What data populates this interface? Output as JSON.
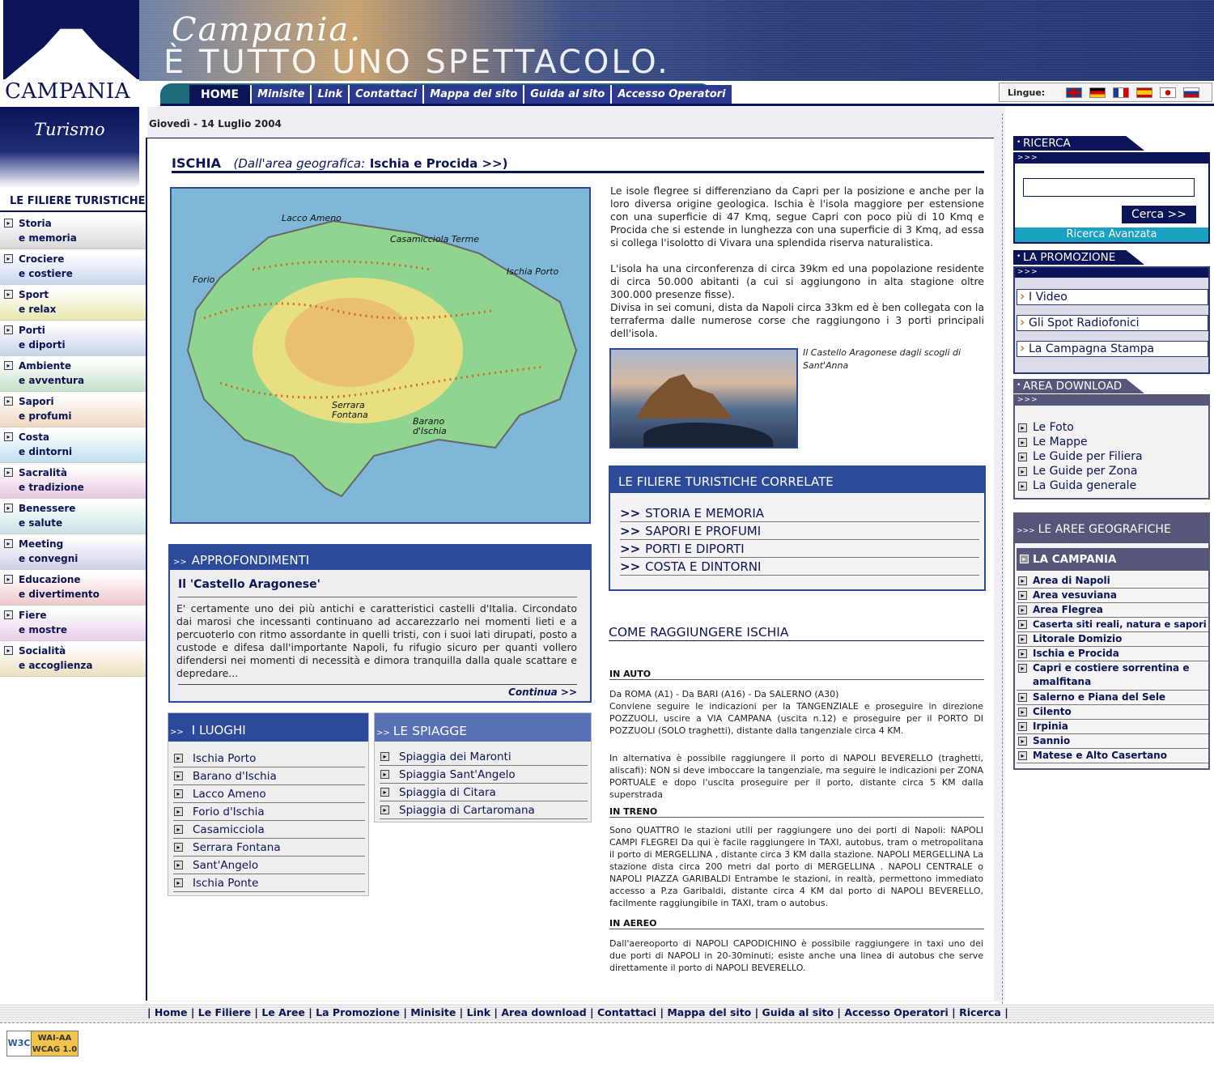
{
  "header": {
    "logo_text": "CAMPANIA",
    "logo_subtitle": "Turismo",
    "banner_line1": "Campania.",
    "banner_line2": "È TUTTO UNO SPETTACOLO.",
    "menu": [
      "HOME",
      "Minisite",
      "Link",
      "Contattaci",
      "Mappa del sito",
      "Guida al sito",
      "Accesso Operatori"
    ],
    "languages_label": "Lingue:",
    "languages": [
      "english-flag-icon",
      "german-flag-icon",
      "french-flag-icon",
      "spanish-flag-icon",
      "japanese-flag-icon",
      "russian-flag-icon"
    ]
  },
  "date": "Giovedì - 14 Luglio 2004",
  "left_nav": {
    "title": "LE FILIERE TURISTICHE",
    "items": [
      {
        "l1": "Storia",
        "l2": "e memoria",
        "color": "#d9d9d9"
      },
      {
        "l1": "Crociere",
        "l2": "e costiere",
        "color": "#c8d8ee"
      },
      {
        "l1": "Sport",
        "l2": "e relax",
        "color": "#e8e8b0"
      },
      {
        "l1": "Porti",
        "l2": "e diporti",
        "color": "#c8d4e8"
      },
      {
        "l1": "Ambiente",
        "l2": "e avventura",
        "color": "#c8e0c8"
      },
      {
        "l1": "Sapori",
        "l2": "e profumi",
        "color": "#f0d8c0"
      },
      {
        "l1": "Costa",
        "l2": "e dintorni",
        "color": "#c0e0f0"
      },
      {
        "l1": "Sacralità",
        "l2": "e tradizione",
        "color": "#e8c8e0"
      },
      {
        "l1": "Benessere",
        "l2": "e salute",
        "color": "#c8e4e4"
      },
      {
        "l1": "Meeting",
        "l2": "e convegni",
        "color": "#d0d0e8"
      },
      {
        "l1": "Educazione",
        "l2": "e divertimento",
        "color": "#f0c8c8"
      },
      {
        "l1": "Fiere",
        "l2": "e mostre",
        "color": "#e8d0e8"
      },
      {
        "l1": "Socialità",
        "l2": "e accoglienza",
        "color": "#ece0c0"
      }
    ]
  },
  "page": {
    "title": "ISCHIA",
    "area_prefix": "(Dall'area geografica:",
    "area_link": "Ischia e Procida >>)"
  },
  "map_labels": {
    "lacco": "Lacco  Ameno",
    "casamicciola": "Casamicciola  Terme",
    "ischia_porto": "Ischia  Porto",
    "forio": "Forio",
    "serrara": "Serrara Fontana",
    "barano": "Barano d'Ischia"
  },
  "description": {
    "p1": "Le isole flegree si differenziano da Capri per la posizione e anche per la loro diversa origine geologica. Ischia è l'isola maggiore per estensione con una superficie di 47 Kmq, segue Capri con poco più di 10 Kmq e Procida che si estende in lunghezza con una superficie di 3 Kmq, ad essa si collega l'isolotto di Vivara una splendida riserva naturalistica.",
    "p2": "L'isola ha una circonferenza di circa 39km ed una popolazione residente di circa 50.000 abitanti (a cui si aggiungono in alta stagione oltre 300.000 presenze fisse).",
    "p3": "Divisa in sei comuni, dista da Napoli circa 33km ed è ben collegata con la terraferma dalle numerose corse che raggiungono i 3 porti principali dell'isola."
  },
  "photo_caption": "Il Castello Aragonese dagli scogli di Sant'Anna",
  "correlate": {
    "title": "LE FILIERE TURISTICHE CORRELATE",
    "items": [
      "STORIA E MEMORIA",
      "SAPORI E PROFUMI",
      "PORTI E DIPORTI",
      "COSTA E DINTORNI"
    ],
    "marker": ">>"
  },
  "come": {
    "title": "COME RAGGIUNGERE ISCHIA",
    "auto_h": "IN AUTO",
    "auto_1": "Da ROMA (A1) - Da BARI (A16) - Da SALERNO (A30)",
    "auto_2": "Conviene seguire le indicazioni per la TANGENZIALE e proseguire in direzione POZZUOLI, uscire a VIA CAMPANA (uscita n.12) e proseguire per il PORTO DI POZZUOLI (SOLO traghetti), distante dalla tangenziale circa 4 KM.",
    "auto_3": "In alternativa è possibile raggiungere il porto di NAPOLI BEVERELLO (traghetti, aliscafi): NON si deve imboccare la tangenziale, ma seguire le indicazioni per ZONA PORTUALE e dopo l'uscita proseguire per il porto, distante circa 5 KM dalla superstrada",
    "treno_h": "IN TRENO",
    "treno": "Sono QUATTRO le stazioni utili per raggiungere uno dei porti di Napoli: NAPOLI CAMPI FLEGREI Da qui è facile raggiungere in TAXI, autobus, tram o metropolitana il porto di MERGELLINA , distante circa 3 KM dalla stazione. NAPOLI MERGELLINA La stazione dista circa 200 metri dal porto di MERGELLINA . NAPOLI CENTRALE o NAPOLI PIAZZA GARIBALDI Entrambe le stazioni, in realtà, permettono immediato accesso a P.za Garibaldi, distante circa 4 KM dal porto di NAPOLI BEVERELLO, facilmente raggiungibile in TAXI, tram o autobus.",
    "aereo_h": "IN AEREO",
    "aereo": "Dall'aereoporto di NAPOLI CAPODICHINO è possibile raggiungere in taxi uno dei due porti di NAPOLI in 20-30minuti; esiste anche una linea di autobus che serve direttamente il porto di NAPOLI BEVERELLO."
  },
  "approfondimenti": {
    "marker": ">>",
    "title": "APPROFONDIMENTI",
    "subtitle": "Il 'Castello Aragonese'",
    "body": "E' certamente uno dei più antichi e caratteristici castelli d'Italia. Circondato dai marosi che incessanti continuano ad accarezzarlo nei momenti lieti e a percuoterlo con ritmo assordante in quelli tristi, con i suoi lati dirupati, posto a custode e difesa dall'importante Napoli, fu rifugio sicuro per quanti vollero difendersi nei momenti di necessità e dimora tranquilla dalla quale scattare e depredare...",
    "more": "Continua >>"
  },
  "luoghi": {
    "marker": ">>",
    "title": "I LUOGHI",
    "items": [
      "Ischia Porto",
      "Barano d'Ischia",
      "Lacco Ameno",
      "Forio d'Ischia",
      "Casamicciola",
      "Serrara Fontana",
      "Sant'Angelo",
      "Ischia Ponte"
    ]
  },
  "spiagge": {
    "marker": ">>",
    "title": "LE SPIAGGE",
    "items": [
      "Spiaggia dei Maronti",
      "Spiaggia Sant'Angelo",
      "Spiaggia di Citara",
      "Spiaggia di Cartaromana"
    ]
  },
  "right": {
    "arrows": ">>>",
    "ricerca_title": "RICERCA",
    "search_value": "",
    "search_button": "Cerca >>",
    "advanced": "Ricerca Avanzata",
    "promo_title": "LA PROMOZIONE",
    "promo_items": [
      "I Video",
      "Gli Spot Radiofonici",
      "La Campagna Stampa"
    ],
    "download_title": "AREA DOWNLOAD",
    "download_items": [
      "Le Foto",
      "Le Mappe",
      "Le Guide per Filiera",
      "Le Guide per Zona",
      "La Guida generale"
    ],
    "aree_title": "LE AREE GEOGRAFICHE",
    "campania": "LA CAMPANIA",
    "aree_items": [
      "Area di Napoli",
      "Area vesuviana",
      "Area Flegrea",
      "Caserta siti reali, natura e sapori",
      "Litorale Domizio",
      "Ischia e Procida",
      "Capri e costiere sorrentina e amalfitana",
      "Salerno e Piana del Sele",
      "Cilento",
      "Irpinia",
      "Sannio",
      "Matese e Alto Casertano"
    ]
  },
  "footer": {
    "links": "| Home | Le Filiere | Le Aree | La Promozione | Minisite | Link | Area download | Contattaci | Mappa del sito | Guida al sito | Accesso Operatori | Ricerca |",
    "w3c": "W3C",
    "wai": "WAI-AA",
    "wcag": "WCAG 1.0"
  }
}
